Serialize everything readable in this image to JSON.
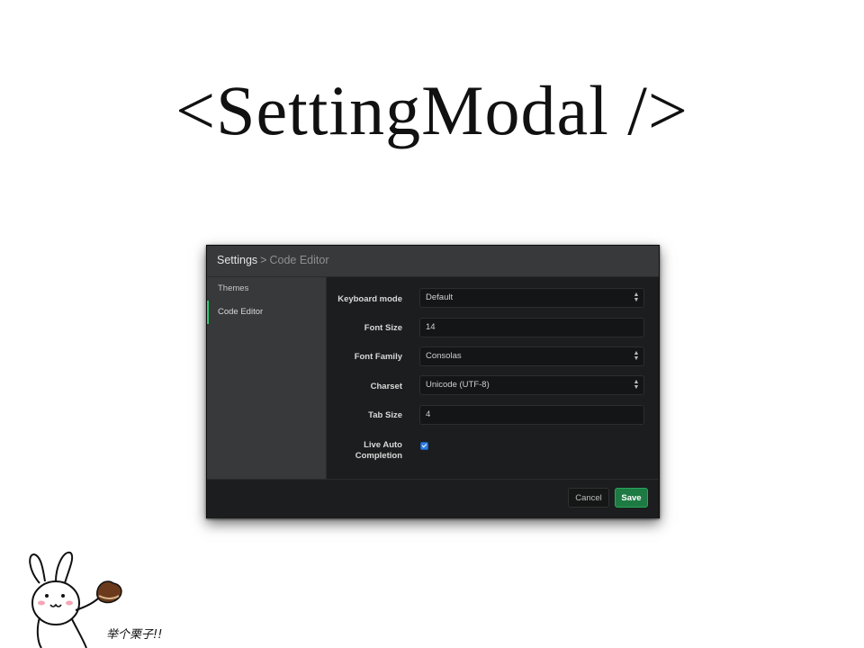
{
  "slide": {
    "title": "<SettingModal />",
    "mascot_caption": "举个栗子!!"
  },
  "modal": {
    "breadcrumb": {
      "root": "Settings",
      "separator": ">",
      "current": "Code Editor"
    },
    "sidebar": {
      "items": [
        {
          "label": "Themes",
          "active": false
        },
        {
          "label": "Code Editor",
          "active": true
        }
      ]
    },
    "form": {
      "keyboard_mode": {
        "label": "Keyboard mode",
        "value": "Default"
      },
      "font_size": {
        "label": "Font Size",
        "value": "14"
      },
      "font_family": {
        "label": "Font Family",
        "value": "Consolas"
      },
      "charset": {
        "label": "Charset",
        "value": "Unicode (UTF-8)"
      },
      "tab_size": {
        "label": "Tab Size",
        "value": "4"
      },
      "live_auto_completion": {
        "label_line1": "Live Auto",
        "label_line2": "Completion",
        "checked": true
      }
    },
    "footer": {
      "cancel_label": "Cancel",
      "save_label": "Save"
    }
  },
  "colors": {
    "accent_active": "#2ecc71",
    "save_button": "#1e7a43",
    "checkbox": "#2f7de1",
    "modal_bg": "#1c1d1e",
    "panel_bg": "#38393b"
  },
  "icons": [
    "select-arrows-icon",
    "checkbox-checked-icon",
    "mascot-illustration"
  ]
}
